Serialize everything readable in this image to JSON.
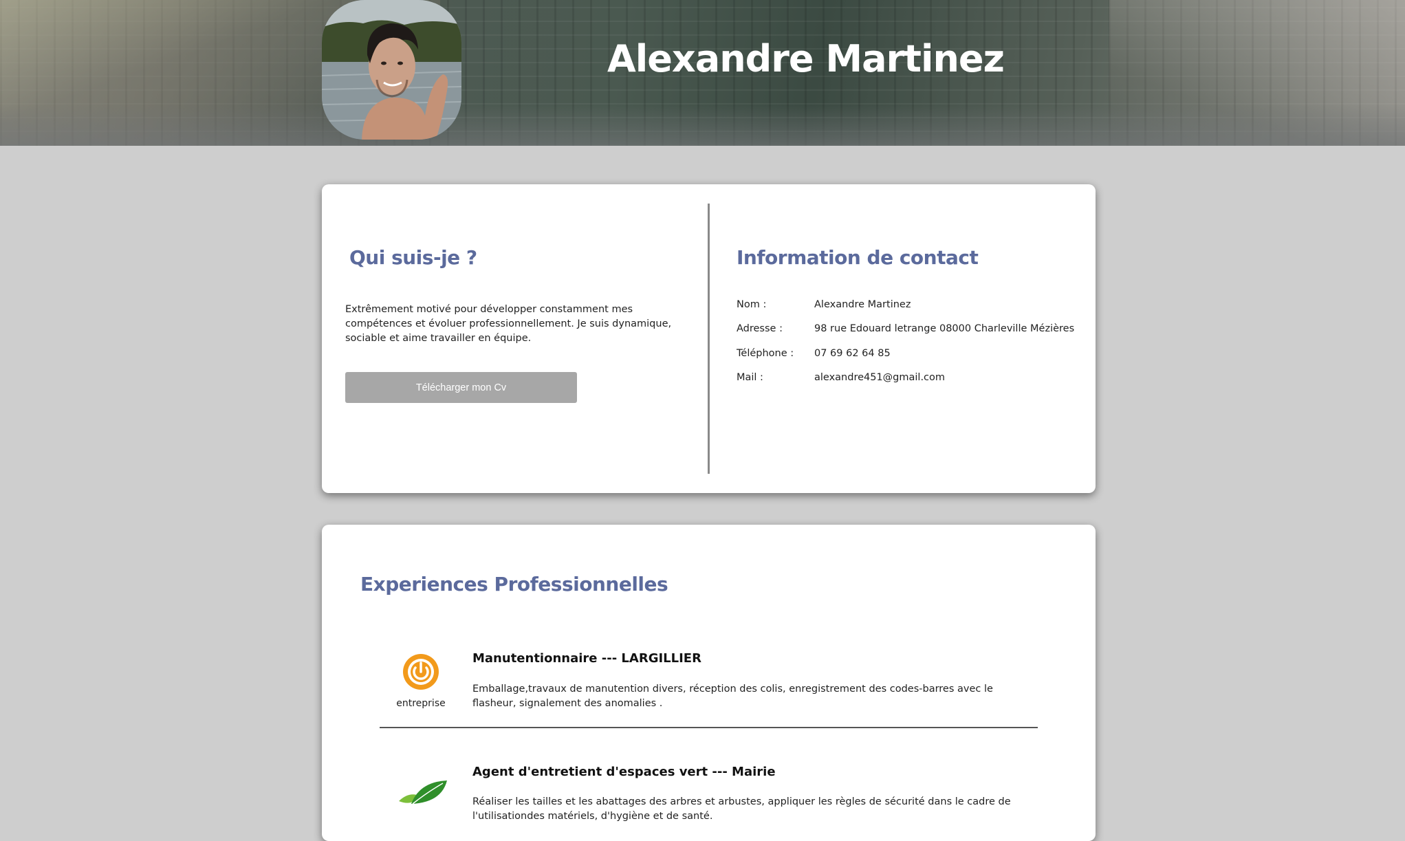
{
  "header": {
    "name": "Alexandre Martinez"
  },
  "about": {
    "title": "Qui suis-je ?",
    "text": "Extrêmement motivé pour développer constamment mes compétences et évoluer professionnellement. Je suis dynamique, sociable et aime travailler en équipe.",
    "cv_button_label": "Télécharger mon Cv"
  },
  "contact": {
    "title": "Information de contact",
    "rows": [
      {
        "label": "Nom :",
        "value": "Alexandre Martinez"
      },
      {
        "label": "Adresse :",
        "value": "98 rue Edouard letrange 08000 Charleville Mézières"
      },
      {
        "label": "Téléphone :",
        "value": "07 69 62 64 85"
      },
      {
        "label": "Mail :",
        "value": "alexandre451@gmail.com"
      }
    ]
  },
  "experiences": {
    "title": "Experiences Professionnelles",
    "items": [
      {
        "title": "Manutentionnaire --- LARGILLIER",
        "description": "Emballage,travaux de manutention divers, réception des colis, enregistrement des codes-barres avec le flasheur, signalement des anomalies .",
        "logo_icon": "power-entreprise-logo",
        "logo_text": "entreprise"
      },
      {
        "title": "Agent d'entretient d'espaces vert --- Mairie",
        "description": "Réaliser les tailles et les abattages des arbres et arbustes, appliquer les règles de sécurité dans le cadre de l'utilisationdes matériels, d'hygiène et de santé.",
        "logo_icon": "green-leaves-logo"
      }
    ]
  },
  "colors": {
    "page_background": "#cecece",
    "card_background": "#ffffff",
    "heading_accent": "#5b6a9c",
    "button_background": "#a7a7a7",
    "logo_orange": "#f29a1b",
    "logo_green": "#3a9a2e"
  }
}
